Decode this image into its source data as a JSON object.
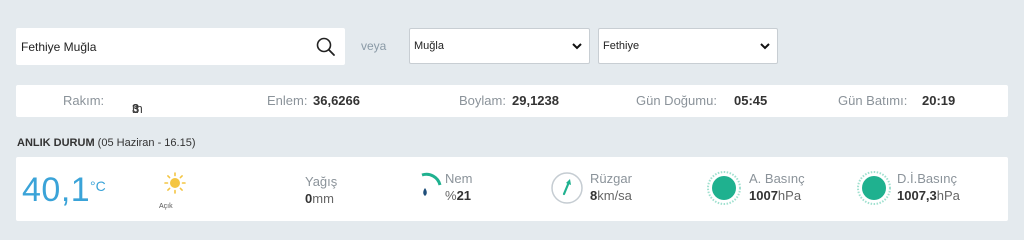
{
  "search": {
    "value": "Fethiye Muğla"
  },
  "or_label": "veya",
  "selects": {
    "province": "Muğla",
    "district": "Fethiye"
  },
  "location": {
    "altitude_label": "Rakım:",
    "altitude_value": "3",
    "altitude_unit": "m",
    "latitude_label": "Enlem:",
    "latitude_value": "36,6266",
    "longitude_label": "Boylam:",
    "longitude_value": "29,1238",
    "sunrise_label": "Gün Doğumu:",
    "sunrise_value": "05:45",
    "sunset_label": "Gün Batımı:",
    "sunset_value": "20:19"
  },
  "current": {
    "title": "ANLIK DURUM",
    "subtitle": "(05 Haziran - 16.15)",
    "temperature": "40,1",
    "temperature_unit": "°C",
    "condition": "Açık",
    "condition_icon": "sun-icon",
    "precip_label": "Yağış",
    "precip_value": "0",
    "precip_unit": "mm",
    "humidity_label": "Nem",
    "humidity_prefix": "%",
    "humidity_value": "21",
    "wind_label": "Rüzgar",
    "wind_value": "8",
    "wind_unit": "km/sa",
    "pressure_label": "A. Basınç",
    "pressure_value": "1007",
    "pressure_unit": "hPa",
    "sea_pressure_label": "D.İ.Basınç",
    "sea_pressure_value": "1007,3",
    "sea_pressure_unit": "hPa"
  },
  "colors": {
    "accent": "#3aa3d8",
    "teal": "#1fb18f",
    "background": "#e4eaee",
    "sun": "#f4c542"
  }
}
